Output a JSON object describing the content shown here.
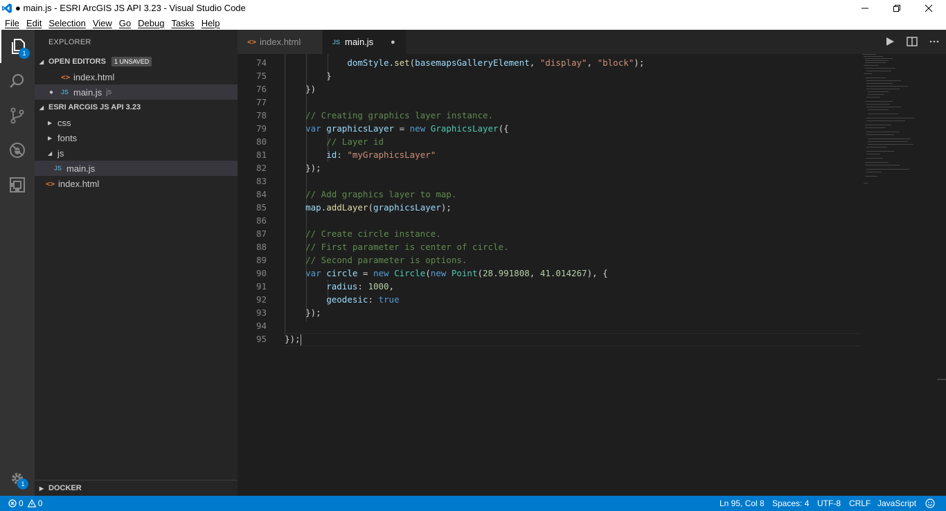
{
  "window": {
    "title": "● main.js - ESRI ArcGIS JS API 3.23 - Visual Studio Code"
  },
  "menu": [
    "File",
    "Edit",
    "Selection",
    "View",
    "Go",
    "Debug",
    "Tasks",
    "Help"
  ],
  "activity": {
    "explorer_badge": "1",
    "settings_badge": "1"
  },
  "sidebar": {
    "title": "EXPLORER",
    "open_editors": {
      "label": "OPEN EDITORS",
      "badge": "1 UNSAVED",
      "items": [
        {
          "name": "index.html"
        },
        {
          "name": "main.js",
          "hint": "js"
        }
      ]
    },
    "project": {
      "label": "ESRI ARCGIS JS API 3.23",
      "items": [
        "css",
        "fonts",
        "js",
        "main.js",
        "index.html"
      ]
    },
    "docker": {
      "label": "DOCKER"
    }
  },
  "tabs": [
    {
      "label": "index.html"
    },
    {
      "label": "main.js",
      "modified": "●"
    }
  ],
  "editor": {
    "line_numbers": [
      "74",
      "75",
      "76",
      "77",
      "78",
      "79",
      "80",
      "81",
      "82",
      "83",
      "84",
      "85",
      "86",
      "87",
      "88",
      "89",
      "90",
      "91",
      "92",
      "93",
      "94",
      "95"
    ],
    "code": {
      "l74_obj": "domStyle",
      "l74_fn": "set",
      "l74_arg": "basemapsGalleryElement",
      "l74_s1": "\"display\"",
      "l74_s2": "\"block\"",
      "l78": "// Creating graphics layer instance.",
      "l79_var": "var",
      "l79_name": "graphicsLayer",
      "l79_new": "new",
      "l79_cls": "GraphicsLayer",
      "l80": "// Layer id",
      "l81_key": "id",
      "l81_val": "\"myGraphicsLayer\"",
      "l84": "// Add graphics layer to map.",
      "l85_obj": "map",
      "l85_fn": "addLayer",
      "l85_arg": "graphicsLayer",
      "l87": "// Create circle instance.",
      "l88": "// First parameter is center of circle.",
      "l89": "// Second parameter is options.",
      "l90_var": "var",
      "l90_name": "circle",
      "l90_new": "new",
      "l90_cls": "Circle",
      "l90_new2": "new",
      "l90_cls2": "Point",
      "l90_n1": "28.991808",
      "l90_n2": "41.014267",
      "l91_key": "radius",
      "l91_val": "1000",
      "l92_key": "geodesic",
      "l92_val": "true"
    }
  },
  "status": {
    "errors": "0",
    "warnings": "0",
    "position": "Ln 95, Col 8",
    "spaces": "Spaces: 4",
    "encoding": "UTF-8",
    "eol": "CRLF",
    "language": "JavaScript"
  },
  "colors": {
    "accent": "#007acc",
    "activitybar": "#333333",
    "sidebar": "#252526",
    "editor": "#1e1e1e"
  }
}
